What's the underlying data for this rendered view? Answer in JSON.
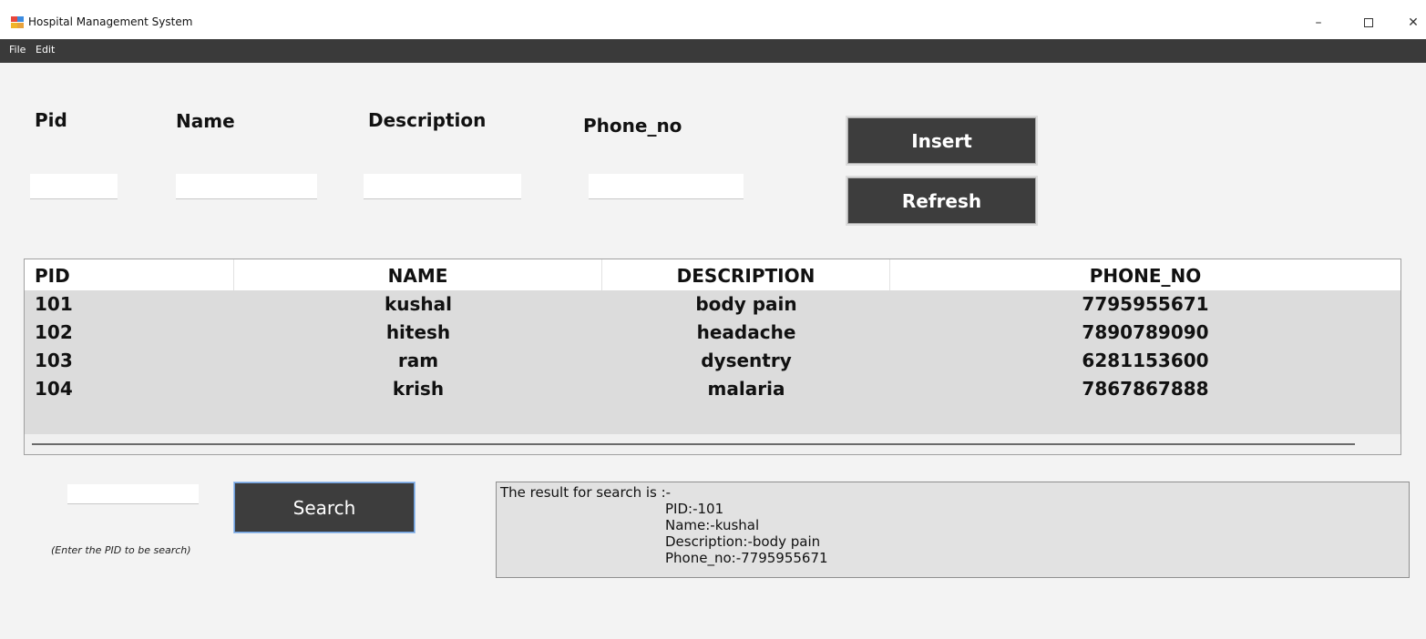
{
  "window": {
    "title": "Hospital  Management System",
    "minimize": "–",
    "close": "✕"
  },
  "menu": {
    "file": "File",
    "edit": "Edit"
  },
  "form": {
    "pid_label": "Pid",
    "name_label": "Name",
    "description_label": "Description",
    "phone_label": "Phone_no",
    "pid_value": "",
    "name_value": "",
    "description_value": "",
    "phone_value": "",
    "insert_label": "Insert",
    "refresh_label": "Refresh"
  },
  "grid": {
    "columns": [
      "PID",
      "NAME",
      "DESCRIPTION",
      "PHONE_NO"
    ],
    "rows": [
      [
        "101",
        "kushal",
        "body pain",
        "7795955671"
      ],
      [
        "102",
        "hitesh",
        "headache",
        "7890789090"
      ],
      [
        "103",
        "ram",
        "dysentry",
        "6281153600"
      ],
      [
        "104",
        "krish",
        "malaria",
        "7867867888"
      ]
    ]
  },
  "search": {
    "value": "",
    "button_label": "Search",
    "hint": "(Enter the PID to be search)"
  },
  "result": {
    "heading": "The result for search is :-",
    "pid": "PID:-101",
    "name": "Name:-kushal",
    "description": "Description:-body pain",
    "phone": "Phone_no:-7795955671"
  },
  "colors": {
    "menubar": "#3a3a3a",
    "button": "#3d3d3d",
    "background": "#f3f3f3",
    "grid_rows": "#dcdcdc"
  }
}
